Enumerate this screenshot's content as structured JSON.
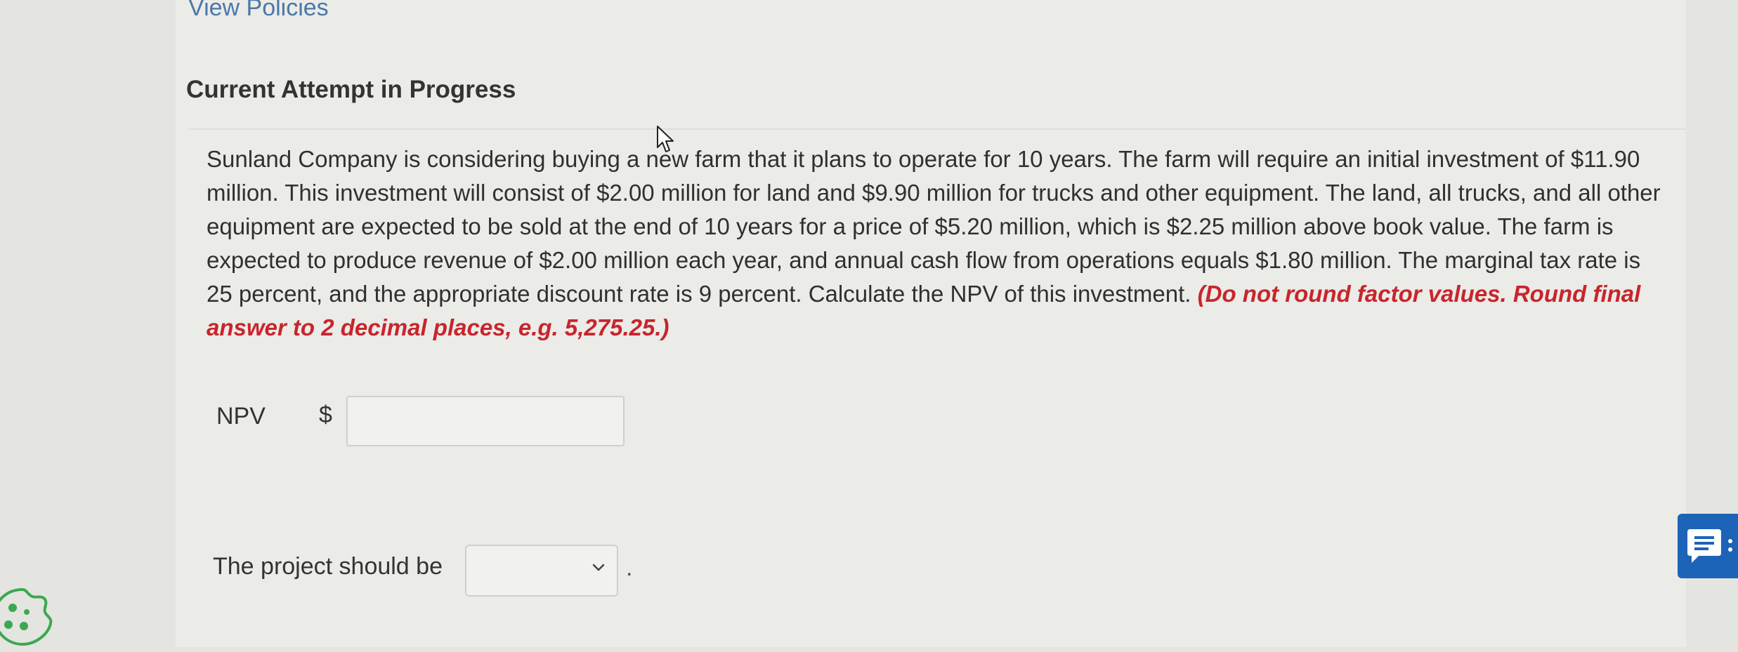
{
  "header": {
    "view_policies_label": "View Policies",
    "attempt_heading": "Current Attempt in Progress"
  },
  "question": {
    "text": "Sunland Company is considering buying a new farm that it plans to operate for 10 years. The farm will require an initial investment of $11.90 million. This investment will consist of $2.00 million for land and $9.90 million for trucks and other equipment. The land, all trucks, and all other equipment are expected to be sold at the end of 10 years for a price of $5.20 million, which is $2.25 million above book value. The farm is expected to produce revenue of $2.00 million each year, and annual cash flow from operations equals $1.80 million. The marginal tax rate is 25 percent, and the appropriate discount rate is 9 percent. Calculate the NPV of this investment. ",
    "instruction": "(Do not round factor values. Round final answer to 2 decimal places, e.g. 5,275.25.)"
  },
  "npv_field": {
    "label": "NPV",
    "currency_symbol": "$",
    "value": ""
  },
  "project_field": {
    "label": "The project should be",
    "selected_value": "",
    "trailing_punctuation": "."
  },
  "icons": {
    "dropdown": "chevron-down-icon",
    "feedback": "feedback-icon",
    "cookie": "cookie-icon",
    "cursor": "mouse-pointer-icon"
  },
  "colors": {
    "link": "#4a78a8",
    "instruction": "#c8252c",
    "feedback_button": "#1d63b8",
    "cookie_icon": "#3ba84f"
  }
}
